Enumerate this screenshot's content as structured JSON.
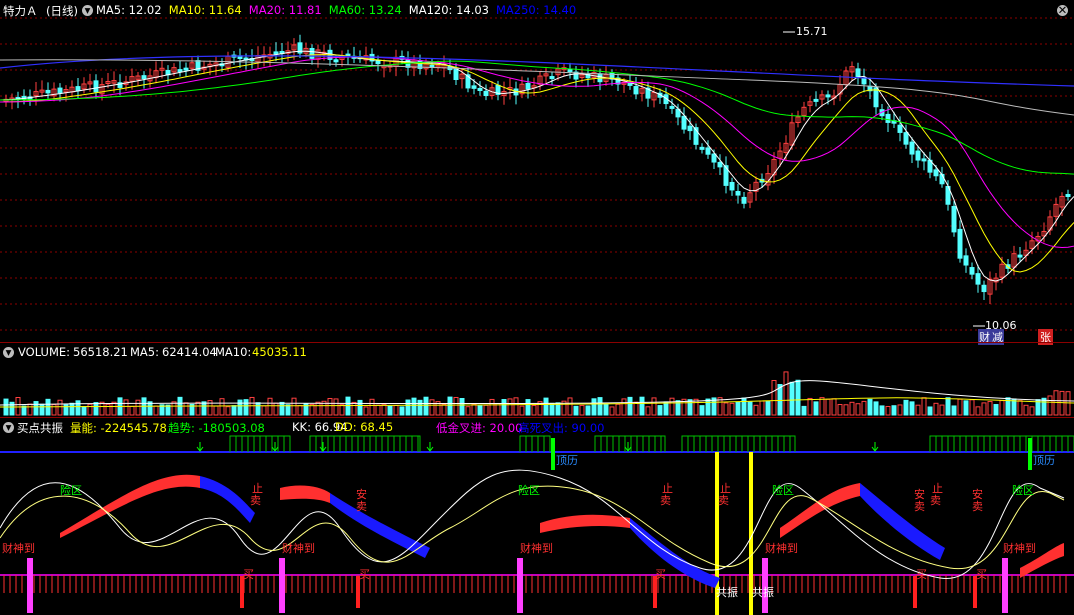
{
  "price_pane": {
    "title": "特力Ａ",
    "period": "(日线)",
    "ma": [
      {
        "label": "MA5:",
        "value": "12.02",
        "color": "#ffffff"
      },
      {
        "label": "MA10:",
        "value": "11.64",
        "color": "#ffff00"
      },
      {
        "label": "MA20:",
        "value": "11.81",
        "color": "#ff00ff"
      },
      {
        "label": "MA60:",
        "value": "13.24",
        "color": "#00ff00"
      },
      {
        "label": "MA120:",
        "value": "14.03",
        "color": "#ffffff"
      },
      {
        "label": "MA250:",
        "value": "14.40",
        "color": "#0000ff"
      }
    ],
    "high_label": "15.71",
    "low_label": "10.06",
    "badges": [
      {
        "text": "财",
        "color": "#ffffff",
        "bg": "#3a3a9a"
      },
      {
        "text": "减",
        "color": "#ffffff",
        "bg": "#3a3a9a"
      },
      {
        "text": "张",
        "color": "#ffffff",
        "bg": "#d02020"
      }
    ]
  },
  "volume_pane": {
    "title": "VOLUME:",
    "value": "56518.21",
    "ma5_label": "MA5:",
    "ma5_value": "62414.04",
    "ma10_label": "MA10:",
    "ma10_value": "45035.11"
  },
  "signal_pane": {
    "title": "买点共振",
    "items": [
      {
        "label": "量能:",
        "value": "-224545.78",
        "color": "#ffff00"
      },
      {
        "label": "趋势:",
        "value": "-180503.08",
        "color": "#00ff00"
      },
      {
        "label": "KK:",
        "value": "66.94",
        "color": "#ffffff"
      },
      {
        "label": "DD:",
        "value": "68.45",
        "color": "#ffff00"
      },
      {
        "label": "低金叉进:",
        "value": "20.00",
        "color": "#ff00ff"
      },
      {
        "label": "高死叉出:",
        "value": "90.00",
        "color": "#0000ff"
      }
    ],
    "annotations": {
      "danger_zone": "险区",
      "wealth": "财神到",
      "stop": "止",
      "sell": "卖",
      "buy": "买",
      "safe": "安",
      "resonance": "共振",
      "peak": "顶历"
    }
  },
  "colors": {
    "background": "#000000",
    "up": "#ff4040",
    "down": "#54ffff",
    "separator": "#8b0000"
  }
}
